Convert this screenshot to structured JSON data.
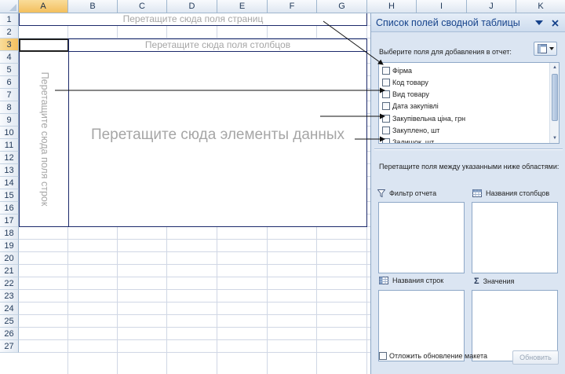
{
  "sheet": {
    "columns": [
      "A",
      "B",
      "C",
      "D",
      "E",
      "F",
      "G",
      "H",
      "I",
      "J",
      "K"
    ],
    "rows": [
      "1",
      "2",
      "3",
      "4",
      "5",
      "6",
      "7",
      "8",
      "9",
      "10",
      "11",
      "12",
      "13",
      "14",
      "15",
      "16",
      "17",
      "18",
      "19",
      "20",
      "21",
      "22",
      "23",
      "24",
      "25",
      "26",
      "27"
    ],
    "selected_column": "A",
    "selected_row": "3"
  },
  "pivot": {
    "page_drop": "Перетащите сюда поля страниц",
    "column_drop": "Перетащите сюда поля столбцов",
    "row_drop": "Перетащите сюда поля строк",
    "data_drop": "Перетащите сюда элементы данных"
  },
  "pane": {
    "title": "Список полей сводной таблицы",
    "choose_fields_label": "Выберите поля для добавления в отчет:",
    "fields": [
      {
        "label": "Фірма",
        "checked": false
      },
      {
        "label": "Код товару",
        "checked": false
      },
      {
        "label": "Вид товару",
        "checked": false
      },
      {
        "label": "Дата закупівлі",
        "checked": false
      },
      {
        "label": "Закупівельна ціна, грн",
        "checked": false
      },
      {
        "label": "Закуплено, шт",
        "checked": false
      },
      {
        "label": "Залишок, шт",
        "checked": false
      }
    ],
    "drag_label": "Перетащите поля между указанными ниже областями:",
    "zones": {
      "report_filter": "Фильтр отчета",
      "column_labels": "Названия столбцов",
      "row_labels": "Названия строк",
      "values": "Значения"
    },
    "defer_update_label": "Отложить обновление макета",
    "update_button": "Обновить"
  },
  "colors": {
    "accent_title": "#15428b",
    "pane_background": "#dbe5f2",
    "drop_area_border": "#1c2a6b",
    "drop_text": "#a6a6a6",
    "selected_header": "#f3bf5d"
  }
}
